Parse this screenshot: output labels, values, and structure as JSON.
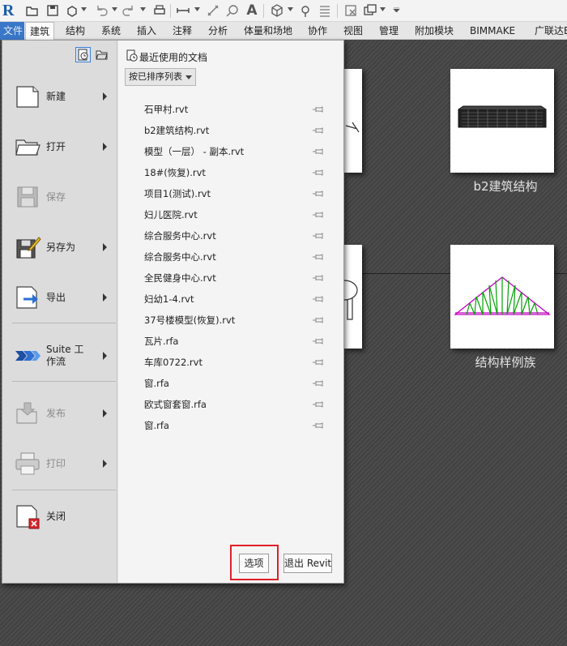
{
  "app": {
    "logo_letter": "R"
  },
  "ribbon_tabs": [
    {
      "label": "文件"
    },
    {
      "label": "建筑"
    },
    {
      "label": "结构"
    },
    {
      "label": "系统"
    },
    {
      "label": "插入"
    },
    {
      "label": "注释"
    },
    {
      "label": "分析"
    },
    {
      "label": "体量和场地"
    },
    {
      "label": "协作"
    },
    {
      "label": "视图"
    },
    {
      "label": "管理"
    },
    {
      "label": "附加模块"
    },
    {
      "label": "BIMMAKE"
    },
    {
      "label": "广联达B"
    }
  ],
  "app_menu": {
    "items": [
      {
        "label": "新建",
        "icon": "new-document-icon",
        "enabled": true,
        "submenu": true
      },
      {
        "label": "打开",
        "icon": "open-folder-icon",
        "enabled": true,
        "submenu": true
      },
      {
        "label": "保存",
        "icon": "save-disk-icon",
        "enabled": false,
        "submenu": false
      },
      {
        "label": "另存为",
        "icon": "save-as-icon",
        "enabled": true,
        "submenu": true
      },
      {
        "label": "导出",
        "icon": "export-icon",
        "enabled": true,
        "submenu": true
      },
      {
        "label": "Suite 工作流",
        "icon": "suite-workflow-icon",
        "enabled": true,
        "submenu": true
      },
      {
        "label": "发布",
        "icon": "publish-icon",
        "enabled": false,
        "submenu": true
      },
      {
        "label": "打印",
        "icon": "printer-icon",
        "enabled": false,
        "submenu": true
      },
      {
        "label": "关闭",
        "icon": "close-document-icon",
        "enabled": true,
        "submenu": false
      }
    ]
  },
  "recent": {
    "title": "最近使用的文档",
    "sort_label": "按已排序列表",
    "documents": [
      "石甲村.rvt",
      "b2建筑结构.rvt",
      "模型（一层） - 副本.rvt",
      "18#(恢复).rvt",
      "项目1(测试).rvt",
      "妇儿医院.rvt",
      "综合服务中心.rvt",
      "综合服务中心.rvt",
      "全民健身中心.rvt",
      "妇幼1-4.rvt",
      "37号楼模型(恢复).rvt",
      "瓦片.rfa",
      "车库0722.rvt",
      "窗.rfa",
      "欧式窗套窗.rfa",
      "窗.rfa"
    ]
  },
  "buttons": {
    "options": "选项",
    "exit": "退出 Revit"
  },
  "background_thumbnails": [
    {
      "label": "b2建筑结构"
    },
    {
      "label": "结构样例族"
    }
  ],
  "colors": {
    "file_tab": "#3a77c9",
    "highlight": "#e0202a",
    "truss": "#c000c0",
    "truss_web": "#00a000"
  }
}
